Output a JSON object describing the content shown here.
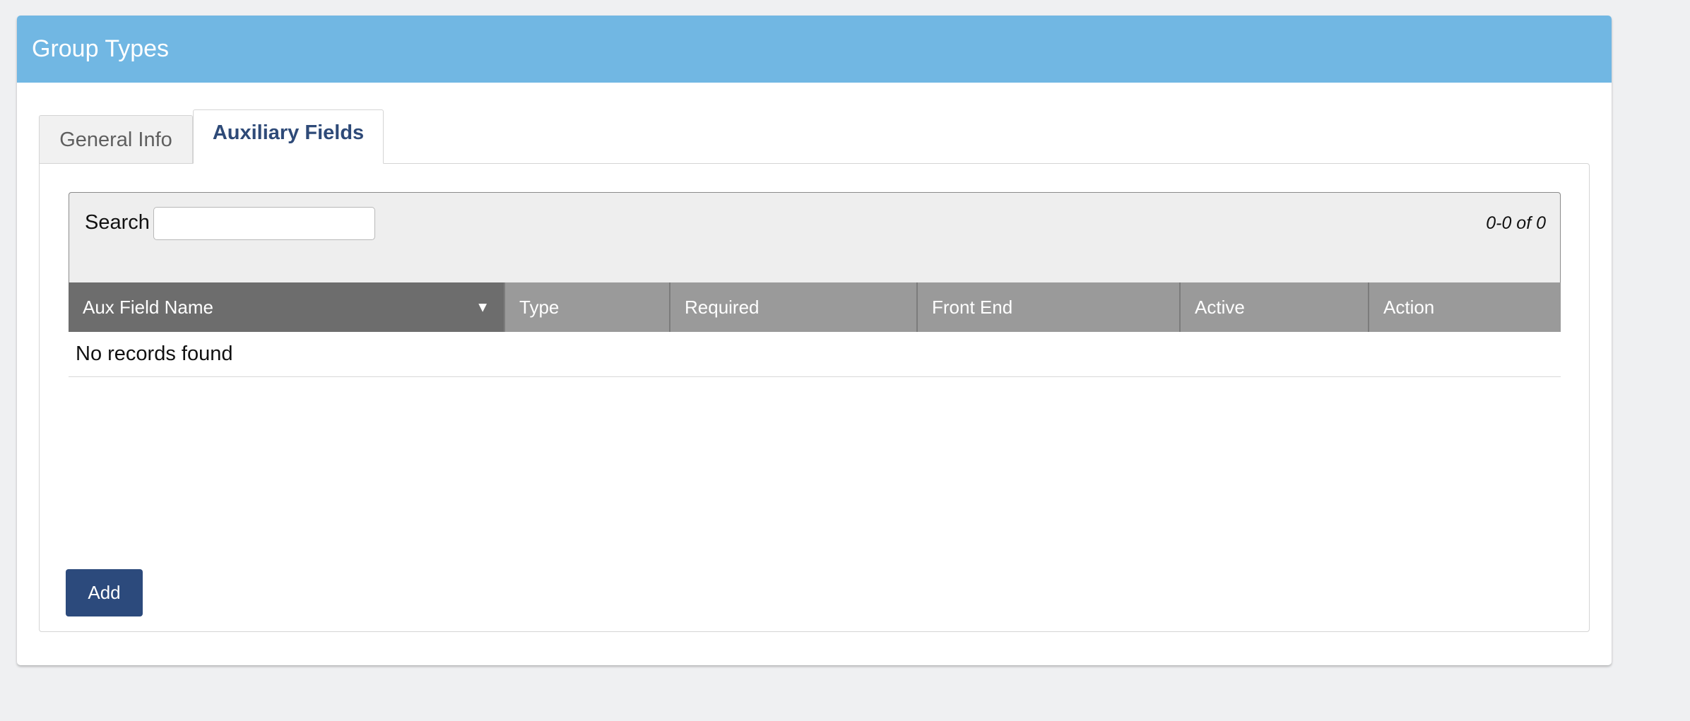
{
  "panel": {
    "title": "Group Types"
  },
  "tabs": [
    {
      "label": "General Info",
      "active": false
    },
    {
      "label": "Auxiliary Fields",
      "active": true
    }
  ],
  "grid": {
    "search_label": "Search",
    "search_value": "",
    "search_placeholder": "",
    "count_text": "0-0 of 0",
    "columns": [
      {
        "label": "Aux Field Name",
        "sorted": "descending"
      },
      {
        "label": "Type"
      },
      {
        "label": "Required"
      },
      {
        "label": "Front End"
      },
      {
        "label": "Active"
      },
      {
        "label": "Action"
      }
    ],
    "empty_message": "No records found",
    "sort_icon": "triangle-down-icon"
  },
  "actions": {
    "add_label": "Add"
  },
  "colors": {
    "header_bg": "#71b7e3",
    "active_tab_text": "#2e4a78",
    "column_header_bg": "#9a9a9a",
    "sorted_column_bg": "#6d6d6d",
    "add_button_bg": "#2c4a7c"
  }
}
